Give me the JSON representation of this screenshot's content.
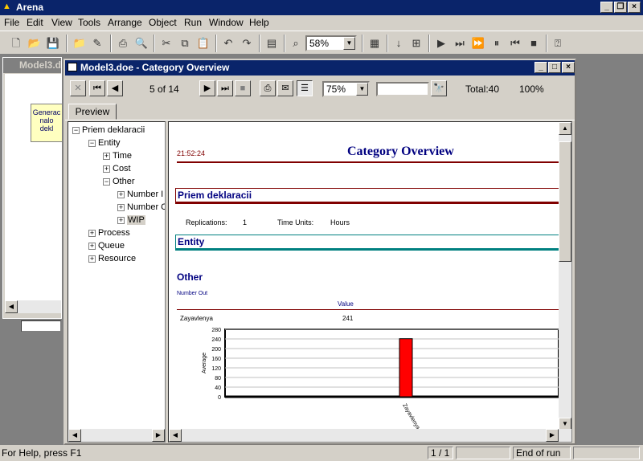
{
  "app": {
    "title": "Arena"
  },
  "menu": [
    "File",
    "Edit",
    "View",
    "Tools",
    "Arrange",
    "Object",
    "Run",
    "Window",
    "Help"
  ],
  "toolbar": {
    "zoom": "58%"
  },
  "bg_window": {
    "title": "Model3.d",
    "node_lines": [
      "Generac",
      "nalo",
      "dekl"
    ]
  },
  "child": {
    "title": "Model3.doe - Category Overview"
  },
  "report_toolbar": {
    "page": "5 of 14",
    "zoom": "75%",
    "search": "",
    "total": "Total:40",
    "percent": "100%"
  },
  "tab": "Preview",
  "tree": [
    {
      "label": "Priem deklaracii",
      "level": 0,
      "exp": "-"
    },
    {
      "label": "Entity",
      "level": 1,
      "exp": "-"
    },
    {
      "label": "Time",
      "level": 2,
      "exp": "+"
    },
    {
      "label": "Cost",
      "level": 2,
      "exp": "+"
    },
    {
      "label": "Other",
      "level": 2,
      "exp": "-"
    },
    {
      "label": "Number I",
      "level": 3,
      "exp": "+"
    },
    {
      "label": "Number C",
      "level": 3,
      "exp": "+"
    },
    {
      "label": "WIP",
      "level": 3,
      "exp": "+"
    },
    {
      "label": "Process",
      "level": 1,
      "exp": "+"
    },
    {
      "label": "Queue",
      "level": 1,
      "exp": "+"
    },
    {
      "label": "Resource",
      "level": 1,
      "exp": "+"
    }
  ],
  "report": {
    "time": "21:52:24",
    "title": "Category Overview",
    "section": "Priem deklaracii",
    "replications_label": "Replications:",
    "replications": "1",
    "time_units_label": "Time Units:",
    "time_units": "Hours",
    "entity": "Entity",
    "other": "Other",
    "number_out": "Number Out",
    "value_header": "Value",
    "row_label": "Zayavlenya",
    "row_value": "241"
  },
  "chart_data": {
    "type": "bar",
    "categories": [
      "Zayavlenya"
    ],
    "values": [
      241
    ],
    "ylabel": "Average",
    "ylim": [
      0,
      280
    ],
    "yticks": [
      0,
      40,
      80,
      120,
      160,
      200,
      240,
      280
    ],
    "bar_color": "#ff0000"
  },
  "status": {
    "help": "For Help, press F1",
    "page": "1 / 1",
    "run": "End of run"
  }
}
